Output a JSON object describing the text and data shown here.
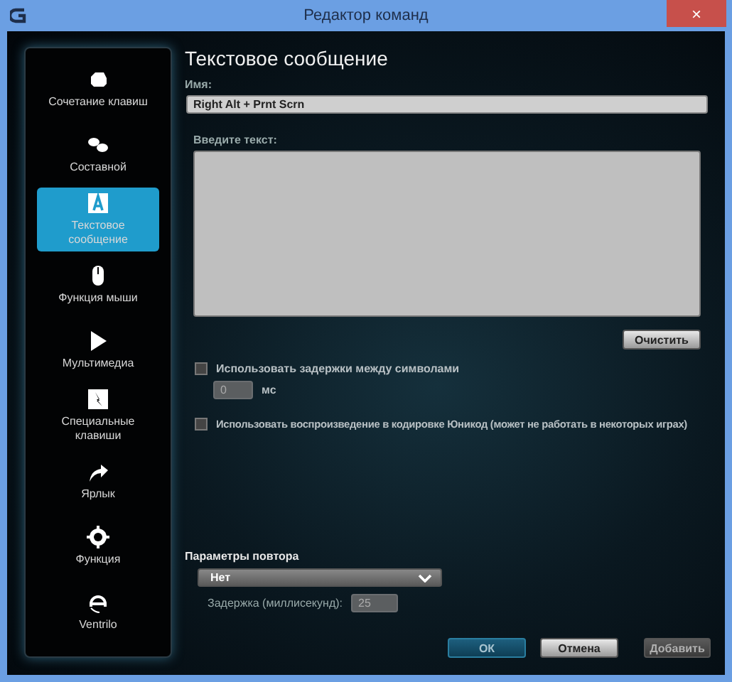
{
  "window": {
    "title": "Редактор команд",
    "close": "×"
  },
  "sidebar": {
    "items": [
      {
        "kind": "keys",
        "label": "Сочетание клавиш",
        "selected": false
      },
      {
        "kind": "composite",
        "label": "Составной",
        "selected": false
      },
      {
        "kind": "text",
        "label": "Текстовое сообщение",
        "selected": true
      },
      {
        "kind": "mouse",
        "label": "Функция мыши",
        "selected": false
      },
      {
        "kind": "media",
        "label": "Мультимедиа",
        "selected": false
      },
      {
        "kind": "special",
        "label": "Специальные клавиши",
        "selected": false
      },
      {
        "kind": "shortcut",
        "label": "Ярлык",
        "selected": false
      },
      {
        "kind": "function",
        "label": "Функция",
        "selected": false
      },
      {
        "kind": "ventrilo",
        "label": "Ventrilo",
        "selected": false
      }
    ]
  },
  "editor": {
    "title": "Текстовое сообщение",
    "name_label": "Имя:",
    "name_value": "Right Alt + Prnt Scrn",
    "text_label": "Введите текст:",
    "clear_button": "Очистить",
    "delay_option": {
      "label": "Использовать задержки между символами",
      "checked": false,
      "value": "0",
      "unit": "мс"
    },
    "unicode_option": {
      "label": "Использовать воспроизведение в кодировке Юникод (может не работать в некоторых играх)",
      "checked": false
    }
  },
  "repeat": {
    "title": "Параметры повтора",
    "mode": "Нет",
    "delay_label": "Задержка (миллисекунд):",
    "delay_value": "25"
  },
  "buttons": [
    {
      "label": "ОК",
      "kind": "primary",
      "disabled": false
    },
    {
      "label": "Отмена",
      "kind": "secondary",
      "disabled": false
    },
    {
      "label": "Добавить",
      "kind": "secondary",
      "disabled": true
    }
  ]
}
